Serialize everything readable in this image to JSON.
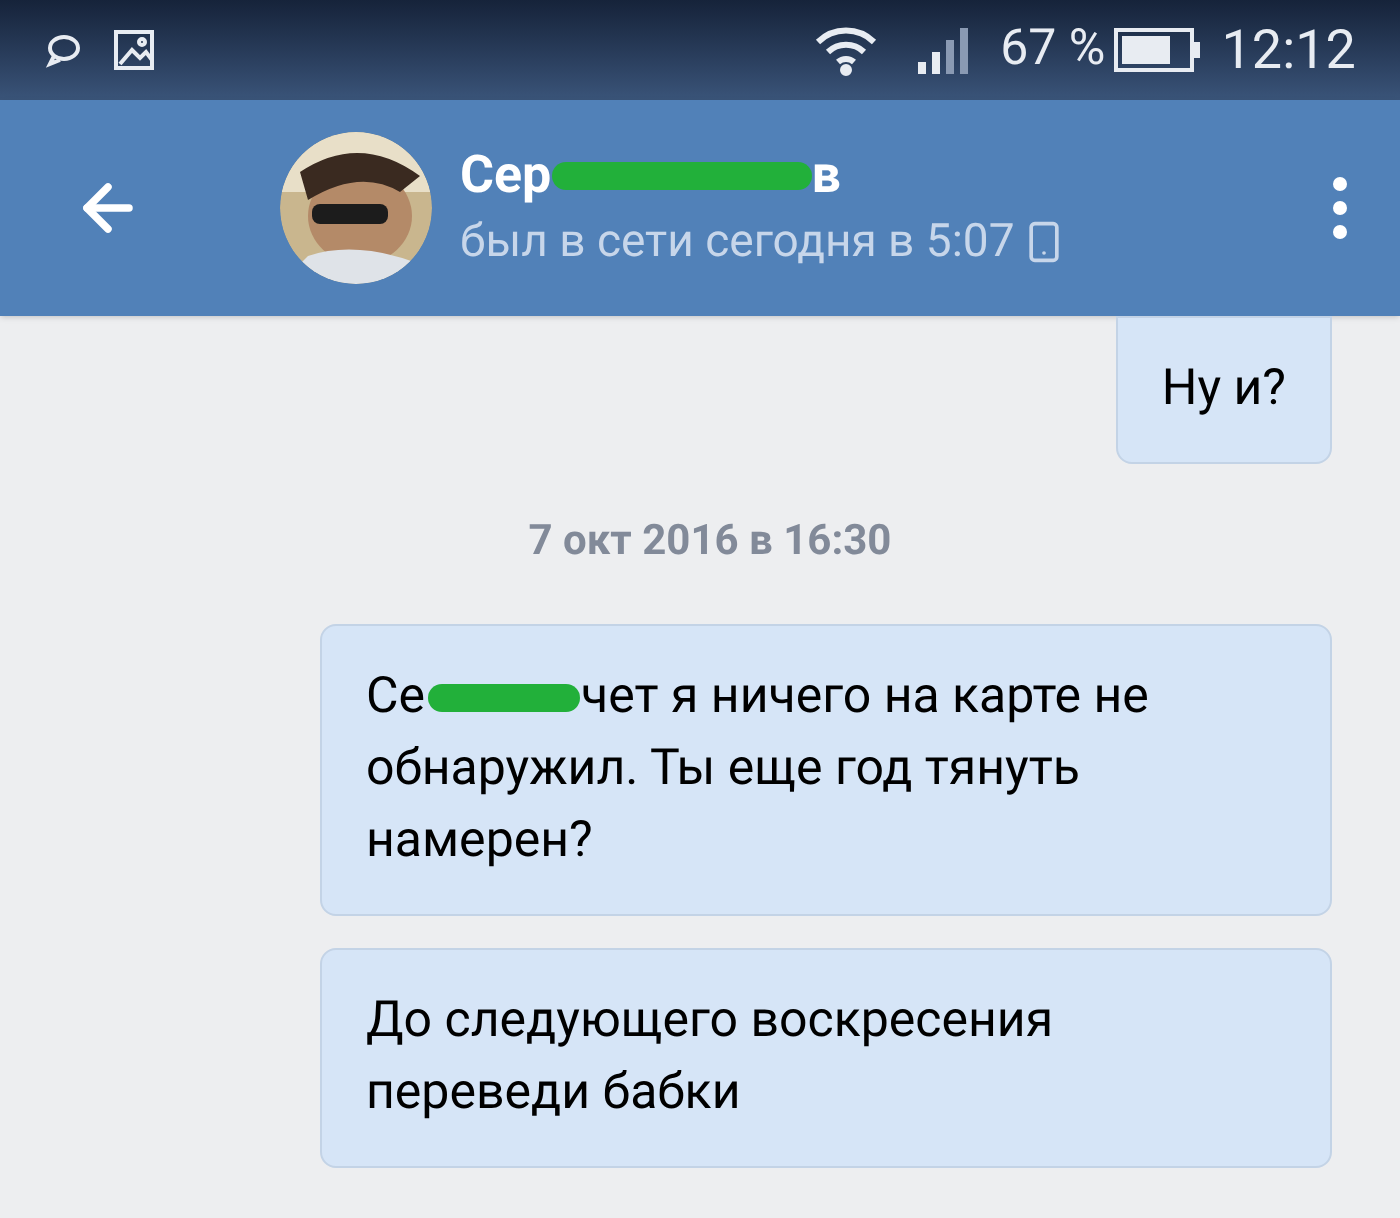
{
  "status_bar": {
    "battery": "67 %",
    "time": "12:12"
  },
  "header": {
    "name_start": "Сер",
    "name_end": "в",
    "last_seen": "был в сети сегодня в 5:07"
  },
  "messages": [
    {
      "kind": "message",
      "parts": [
        "Ну и?"
      ]
    },
    {
      "kind": "date",
      "text": "7 окт 2016 в 16:30"
    },
    {
      "kind": "message",
      "parts": [
        "Се",
        "чет я ничего на карте не обнаружил. Ты еще год тянуть намерен?"
      ]
    },
    {
      "kind": "message",
      "parts": [
        "До следующего воскресения переведи бабки"
      ]
    }
  ]
}
